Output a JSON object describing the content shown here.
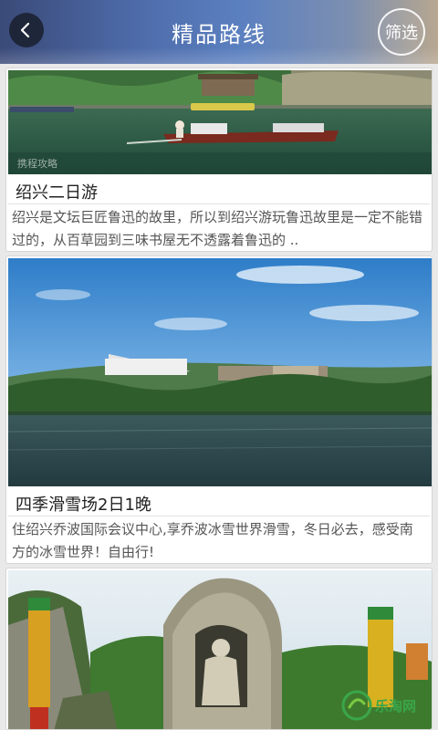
{
  "header": {
    "title": "精品路线",
    "filter_label": "筛选"
  },
  "routes": [
    {
      "title": "绍兴二日游",
      "description": "绍兴是文坛巨匠鲁迅的故里，所以到绍兴游玩鲁迅故里是一定不能错过的，从百草园到三味书屋无不透露着鲁迅的 .."
    },
    {
      "title": "四季滑雪场2日1晚",
      "description": "住绍兴乔波国际会议中心,享乔波冰雪世界滑雪，冬日必去，感受南方的冰雪世界！自由行!"
    }
  ],
  "watermark": "携程攻略",
  "logo": {
    "text": "乐淘网"
  },
  "colors": {
    "header_start": "#3a4a78",
    "header_end": "#b7a790",
    "card_bg": "#ffffff",
    "page_bg": "#e9e9e9",
    "title_text": "#222222",
    "desc_text": "#555555",
    "logo_green": "#3aa64a"
  },
  "icons": [
    "back-arrow-icon",
    "logo-icon"
  ]
}
